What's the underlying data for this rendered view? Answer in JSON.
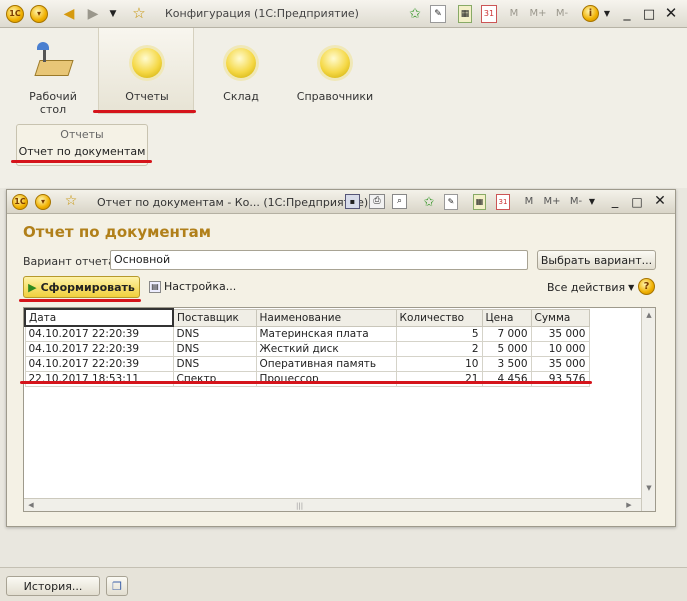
{
  "app": {
    "window_title": "Конфигурация  (1С:Предприятие)",
    "logo": "1С",
    "toolbar_icons": [
      "back-icon",
      "forward-icon",
      "menu-down-icon",
      "star-icon",
      "favorites-add-icon",
      "history-icon",
      "calculator-icon",
      "calendar-icon",
      "memory-m-icon",
      "memory-plus-icon",
      "memory-minus-icon",
      "info-icon",
      "minimize-icon",
      "maximize-icon",
      "close-icon"
    ],
    "mem": {
      "m": "M",
      "mplus": "M+",
      "mminus": "M-",
      "dd": "31"
    }
  },
  "sections": [
    {
      "label": "Рабочий стол",
      "line1": "Рабочий",
      "line2": "стол",
      "icon": "desktop-icon"
    },
    {
      "label": "Отчеты",
      "icon": "reports-orb-icon"
    },
    {
      "label": "Склад",
      "icon": "warehouse-orb-icon"
    },
    {
      "label": "Справочники",
      "icon": "catalogs-orb-icon"
    }
  ],
  "subpanel": {
    "group": "Отчеты",
    "item": "Отчет по документам"
  },
  "inner_window": {
    "title": "Отчет по документам - Ко...  (1С:Предприятие)",
    "heading": "Отчет по документам",
    "variant_label": "Вариант отчета:",
    "variant_value": "Основной",
    "choose_variant": "Выбрать вариант...",
    "generate": "Сформировать",
    "settings": "Настройка...",
    "all_actions": "Все действия",
    "help": "?"
  },
  "report": {
    "columns": [
      "Дата",
      "Поставщик",
      "Наименование",
      "Количество",
      "Цена",
      "Сумма"
    ],
    "rows": [
      [
        "04.10.2017 22:20:39",
        "DNS",
        "Материнская плата",
        "5",
        "7 000",
        "35 000"
      ],
      [
        "04.10.2017 22:20:39",
        "DNS",
        "Жесткий диск",
        "2",
        "5 000",
        "10 000"
      ],
      [
        "04.10.2017 22:20:39",
        "DNS",
        "Оперативная память",
        "10",
        "3 500",
        "35 000"
      ],
      [
        "22.10.2017 18:53:11",
        "Спектр",
        "Процессор",
        "21",
        "4 456",
        "93 576"
      ]
    ]
  },
  "bottom": {
    "history": "История..."
  },
  "colors": {
    "accent": "#b1801a",
    "highlight": "#d5141b"
  }
}
